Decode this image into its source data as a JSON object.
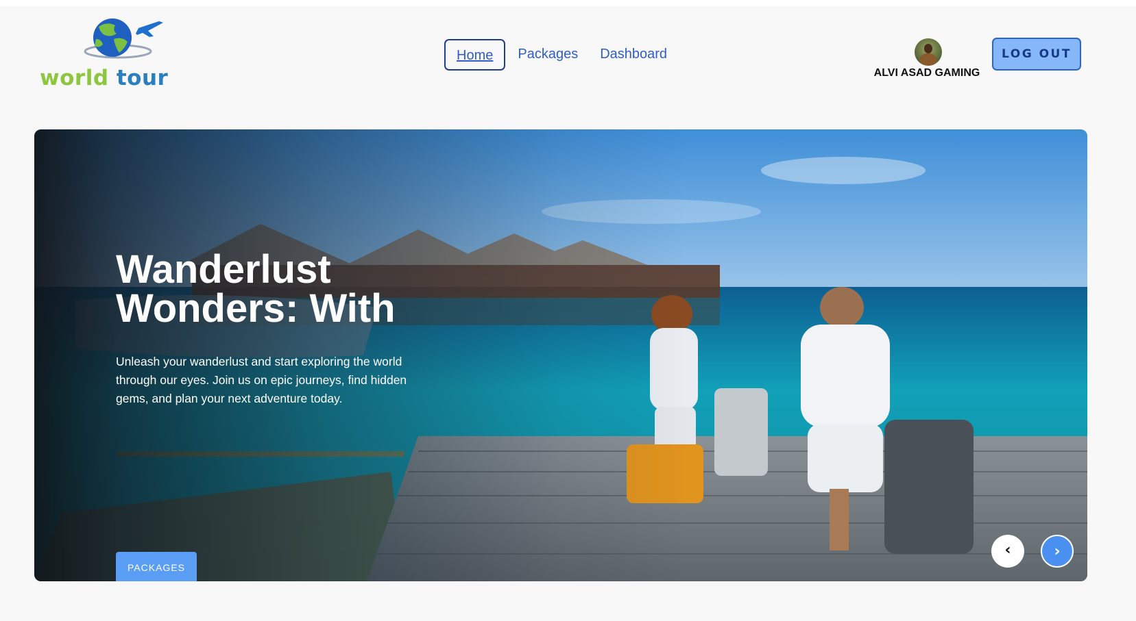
{
  "brand": {
    "word1": "world",
    "word2": "tour",
    "globe_icon": "globe-airplane-icon"
  },
  "nav": {
    "items": [
      {
        "label": "Home",
        "active": true
      },
      {
        "label": "Packages",
        "active": false
      },
      {
        "label": "Dashboard",
        "active": false
      }
    ]
  },
  "user": {
    "name": "ALVI ASAD GAMING",
    "avatar_icon": "user-avatar"
  },
  "header": {
    "logout_label": "LOG OUT"
  },
  "hero": {
    "title_line1": "Wanderlust",
    "title_line2": "Wonders: With",
    "description": "Unleash your wanderlust and start exploring the world through our eyes. Join us on epic journeys, find hidden gems, and plan your next adventure today.",
    "button_label": "PACKAGES",
    "prev_icon": "‹",
    "next_icon": "›"
  },
  "colors": {
    "link": "#2f5ec6",
    "logout_bg": "#86b7f9",
    "hero_button": "#5a9df5",
    "carousel_next": "#4a90f0",
    "brand_green": "#8dc63f",
    "brand_blue": "#2a7fc1"
  }
}
